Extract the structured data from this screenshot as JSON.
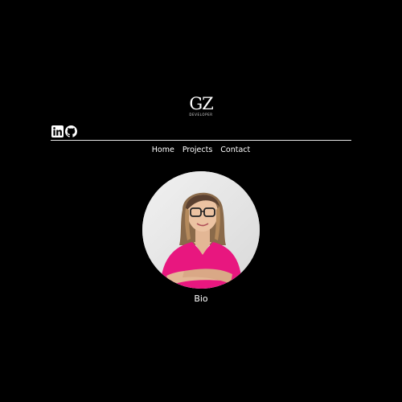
{
  "header": {
    "logo_text": "GZ",
    "logo_subtitle": "DEVELOPER"
  },
  "social": {
    "icons": [
      "linkedin-icon",
      "github-icon"
    ]
  },
  "nav": {
    "items": [
      {
        "label": "Home"
      },
      {
        "label": "Projects"
      },
      {
        "label": "Contact"
      }
    ]
  },
  "profile": {
    "bio_label": "Bio"
  },
  "colors": {
    "background": "#000000",
    "text": "#ffffff",
    "divider": "#e6e6e6",
    "shirt": "#e8177f"
  }
}
